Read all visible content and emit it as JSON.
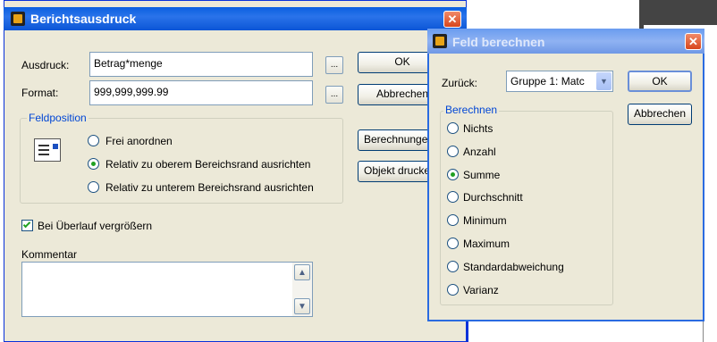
{
  "main_dialog": {
    "title": "Berichtsausdruck",
    "close": "✕",
    "expression_label": "Ausdruck:",
    "expression_value": "Betrag*menge",
    "format_label": "Format:",
    "format_value": "999,999,999.99",
    "ellipsis": "...",
    "ok": "OK",
    "cancel": "Abbrechen",
    "calculate": "Berechnungen...",
    "print_object": "Objekt drucken...",
    "field_position_group": "Feldposition",
    "radio_free": "Frei anordnen",
    "radio_top": "Relativ zu oberem Bereichsrand ausrichten",
    "radio_bottom": "Relativ zu unterem Bereichsrand ausrichten",
    "stretch_checkbox": "Bei Überlauf vergrößern",
    "comment_label": "Kommentar",
    "scroll_up": "▲",
    "scroll_down": "▼"
  },
  "calc_dialog": {
    "title": "Feld berechnen",
    "close": "✕",
    "reset_label": "Zurück:",
    "reset_value": "Gruppe 1: Matc",
    "dropdown_arrow": "▼",
    "ok": "OK",
    "cancel": "Abbrechen",
    "calc_group": "Berechnen",
    "options": [
      "Nichts",
      "Anzahl",
      "Summe",
      "Durchschnitt",
      "Minimum",
      "Maximum",
      "Standardabweichung",
      "Varianz"
    ],
    "selected_index": 2
  },
  "colors": {
    "titlebar": "#0b55d6",
    "dialog_bg": "#ece9d8",
    "group_label": "#0046d5",
    "radio_selected": "#21a121",
    "close_button": "#d8461d"
  }
}
